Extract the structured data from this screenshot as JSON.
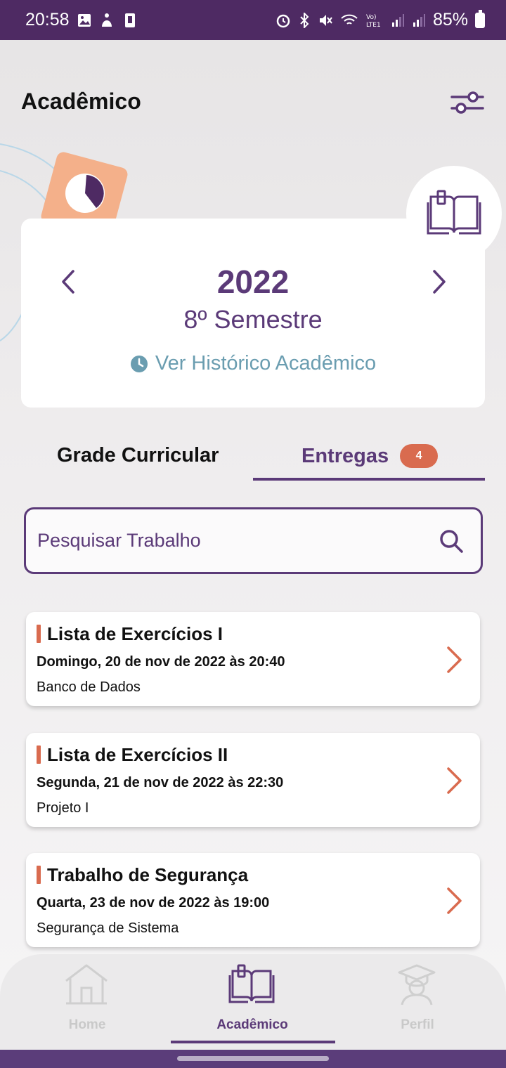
{
  "status_bar": {
    "time": "20:58",
    "battery": "85%"
  },
  "header": {
    "title": "Acadêmico",
    "filter_icon": "sliders-icon"
  },
  "year_card": {
    "year": "2022",
    "semester": "8º Semestre",
    "history_link": "Ver Histórico Acadêmico"
  },
  "tabs": {
    "grade": "Grade Curricular",
    "entregas": "Entregas",
    "entregas_badge": "4",
    "active": "entregas"
  },
  "search": {
    "placeholder": "Pesquisar Trabalho"
  },
  "assignments": [
    {
      "title": "Lista de Exercícios I",
      "date": "Domingo, 20 de nov de 2022 às 20:40",
      "subject": "Banco de Dados"
    },
    {
      "title": "Lista de Exercícios II",
      "date": "Segunda, 21 de nov de 2022 às 22:30",
      "subject": "Projeto I"
    },
    {
      "title": "Trabalho de Segurança",
      "date": "Quarta, 23 de nov de 2022 às 19:00",
      "subject": "Segurança de Sistema"
    }
  ],
  "bottom_nav": {
    "home": "Home",
    "academic": "Acadêmico",
    "profile": "Perfil",
    "active": "academic"
  },
  "colors": {
    "primary": "#5b3a78",
    "accent": "#d96b4f",
    "link": "#6a9db0",
    "status_bar": "#4e2a63"
  }
}
